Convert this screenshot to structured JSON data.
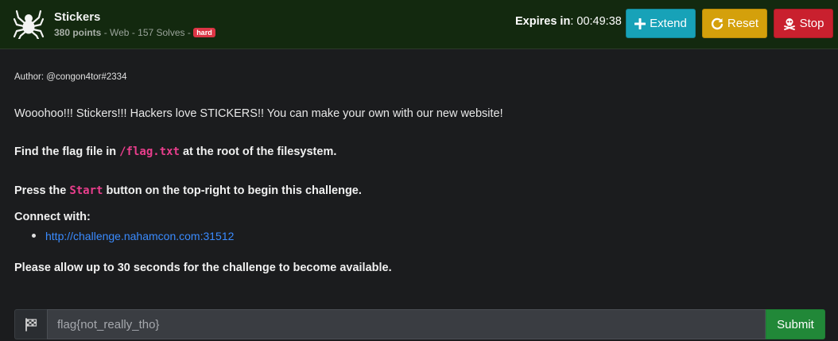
{
  "challenge": {
    "title": "Stickers",
    "points": "380 points",
    "meta_rest": " - Web - 157 Solves - ",
    "difficulty": "hard",
    "logo_icon": "spider-icon"
  },
  "timer": {
    "label": "Expires in",
    "sep": ": ",
    "value": "00:49:38"
  },
  "buttons": {
    "extend": {
      "label": "Extend",
      "icon": "plus-icon",
      "color": "#17a2b8"
    },
    "reset": {
      "label": "Reset",
      "icon": "redo-icon",
      "color": "#d4a00b"
    },
    "stop": {
      "label": "Stop",
      "icon": "skull-crossbones-icon",
      "color": "#c9202e"
    }
  },
  "description": {
    "author": "Author: @congon4tor#2334",
    "intro": "Wooohoo!!! Stickers!!! Hackers love STICKERS!! You can make your own with our new website!",
    "find_pre": "Find the flag file in ",
    "find_code": "/flag.txt",
    "find_post": " at the root of the filesystem.",
    "press_pre": "Press the ",
    "press_code": "Start",
    "press_post": " button on the top-right to begin this challenge.",
    "connect_label": "Connect with:",
    "links": [
      "http://challenge.nahamcon.com:31512"
    ],
    "allow": "Please allow up to 30 seconds for the challenge to become available."
  },
  "flag_form": {
    "icon": "flag-checkered-icon",
    "placeholder": "flag{not_really_tho}",
    "submit_label": "Submit"
  },
  "colors": {
    "header_bg": "#13290f",
    "page_bg": "#1b1c1e",
    "code": "#e83e8c",
    "link": "#3a8bff",
    "submit": "#218838"
  }
}
